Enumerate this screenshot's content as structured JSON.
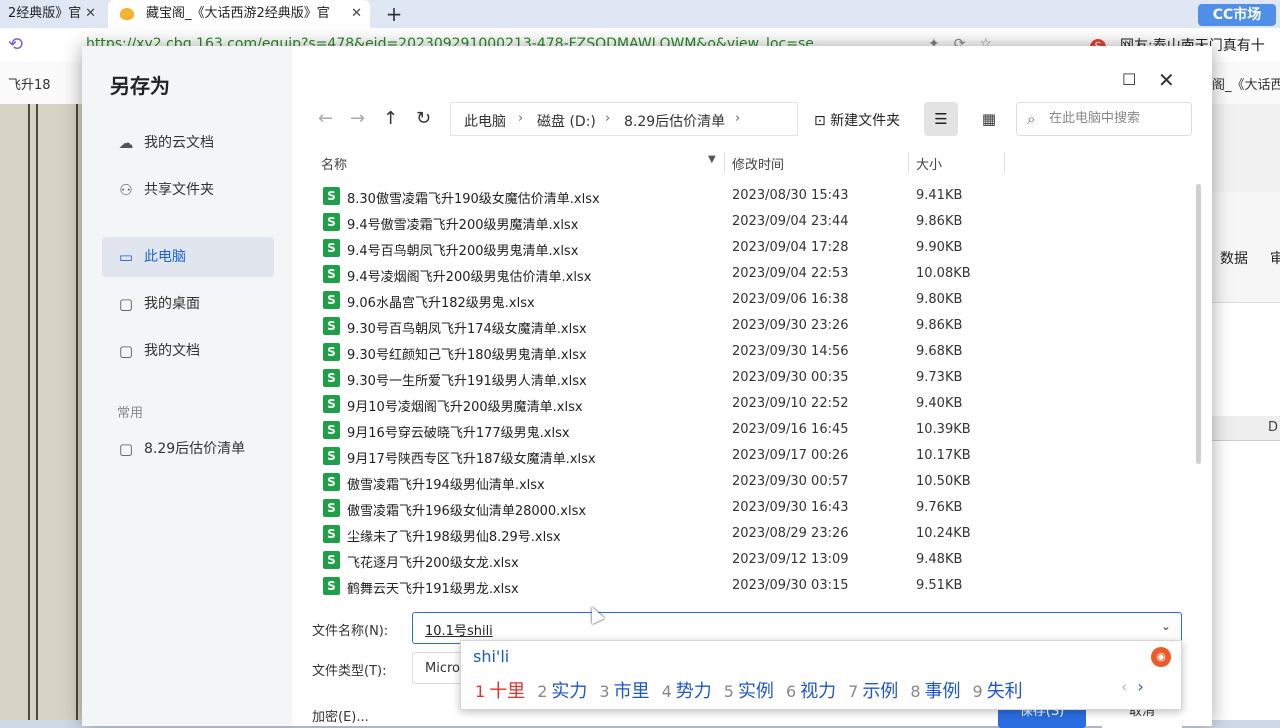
{
  "browser": {
    "tabs": [
      {
        "label": "2经典版》官",
        "close": "✕"
      },
      {
        "label": "藏宝阁_《大话西游2经典版》官",
        "close": "✕"
      }
    ],
    "new_tab": "+",
    "url": "https://xy2.cbg.163.com/equip?s=478&eid=202309291000213-478-FZSODMAWLQWM&o&view_loc=se...",
    "right_news": "网友:泰山南天门真有十",
    "right_news_icon": "S",
    "bookmark_left": "飞升18",
    "bookmark_right": "阁_《大话西",
    "cc_logo": "CC市场"
  },
  "background_app": {
    "ribbon_tab": "数据",
    "ribbon_tab_more": "审",
    "column_label": "D"
  },
  "dialog": {
    "title": "另存为",
    "window_controls": {
      "maximize": "☐",
      "close": "✕"
    },
    "sidebar": {
      "items": [
        {
          "label": "我的云文档",
          "icon": "cloud-icon",
          "glyph": "☁",
          "active": false
        },
        {
          "label": "共享文件夹",
          "icon": "share-folder-icon",
          "glyph": "⚇",
          "active": false
        },
        {
          "label": "此电脑",
          "icon": "computer-icon",
          "glyph": "▭",
          "active": true
        },
        {
          "label": "我的桌面",
          "icon": "folder-icon",
          "glyph": "▢",
          "active": false
        },
        {
          "label": "我的文档",
          "icon": "folder-icon",
          "glyph": "▢",
          "active": false
        }
      ],
      "section_label": "常用",
      "frequent": [
        {
          "label": "8.29后估价清单",
          "icon": "folder-icon",
          "glyph": "▢"
        }
      ]
    },
    "toolbar": {
      "back": "←",
      "forward": "→",
      "up": "↑",
      "refresh": "↻",
      "breadcrumb": [
        "此电脑",
        "磁盘 (D:)",
        "8.29后估价清单"
      ],
      "breadcrumb_sep": "›",
      "new_folder": "新建文件夹",
      "search_placeholder": "在此电脑中搜索"
    },
    "columns": {
      "name": "名称",
      "modified": "修改时间",
      "size": "大小"
    },
    "files": [
      {
        "name": "8.30傲雪凌霜飞升190级女魔估价清单.xlsx",
        "modified": "2023/08/30 15:43",
        "size": "9.41KB"
      },
      {
        "name": "9.4号傲雪凌霜飞升200级男魔清单.xlsx",
        "modified": "2023/09/04 23:44",
        "size": "9.86KB"
      },
      {
        "name": "9.4号百鸟朝凤飞升200级男鬼清单.xlsx",
        "modified": "2023/09/04 17:28",
        "size": "9.90KB"
      },
      {
        "name": "9.4号凌烟阁飞升200级男鬼估价清单.xlsx",
        "modified": "2023/09/04 22:53",
        "size": "10.08KB"
      },
      {
        "name": "9.06水晶宫飞升182级男鬼.xlsx",
        "modified": "2023/09/06 16:38",
        "size": "9.80KB"
      },
      {
        "name": "9.30号百鸟朝凤飞升174级女魔清单.xlsx",
        "modified": "2023/09/30 23:26",
        "size": "9.86KB"
      },
      {
        "name": "9.30号红颜知己飞升180级男鬼清单.xlsx",
        "modified": "2023/09/30 14:56",
        "size": "9.68KB"
      },
      {
        "name": "9.30号一生所爱飞升191级男人清单.xlsx",
        "modified": "2023/09/30 00:35",
        "size": "9.73KB"
      },
      {
        "name": "9月10号凌烟阁飞升200级男魔清单.xlsx",
        "modified": "2023/09/10 22:52",
        "size": "9.40KB"
      },
      {
        "name": "9月16号穿云破晓飞升177级男鬼.xlsx",
        "modified": "2023/09/16 16:45",
        "size": "10.39KB"
      },
      {
        "name": "9月17号陕西专区飞升187级女魔清单.xlsx",
        "modified": "2023/09/17 00:26",
        "size": "10.17KB"
      },
      {
        "name": "傲雪凌霜飞升194级男仙清单.xlsx",
        "modified": "2023/09/30 00:57",
        "size": "10.50KB"
      },
      {
        "name": "傲雪凌霜飞升196级女仙清单28000.xlsx",
        "modified": "2023/09/30 16:43",
        "size": "9.76KB"
      },
      {
        "name": "尘缘未了飞升198级男仙8.29号.xlsx",
        "modified": "2023/08/29 23:26",
        "size": "10.24KB"
      },
      {
        "name": "飞花逐月飞升200级女龙.xlsx",
        "modified": "2023/09/12 13:09",
        "size": "9.48KB"
      },
      {
        "name": "鹤舞云天飞升191级男龙.xlsx",
        "modified": "2023/09/30 03:15",
        "size": "9.51KB"
      }
    ],
    "filename_label": "文件名称(N):",
    "filename_value": "10.1号shili",
    "filetype_label": "文件类型(T):",
    "filetype_value": "Micro",
    "encrypt_label": "加密(E)...",
    "save_label": "保存(S)",
    "cancel_label": "取消"
  },
  "ime": {
    "pinyin": "shi'li",
    "candidates": [
      {
        "num": "1",
        "text": "十里"
      },
      {
        "num": "2",
        "text": "实力"
      },
      {
        "num": "3",
        "text": "市里"
      },
      {
        "num": "4",
        "text": "势力"
      },
      {
        "num": "5",
        "text": "实例"
      },
      {
        "num": "6",
        "text": "视力"
      },
      {
        "num": "7",
        "text": "示例"
      },
      {
        "num": "8",
        "text": "事例"
      },
      {
        "num": "9",
        "text": "失利"
      }
    ],
    "prev": "‹",
    "next": "›"
  }
}
